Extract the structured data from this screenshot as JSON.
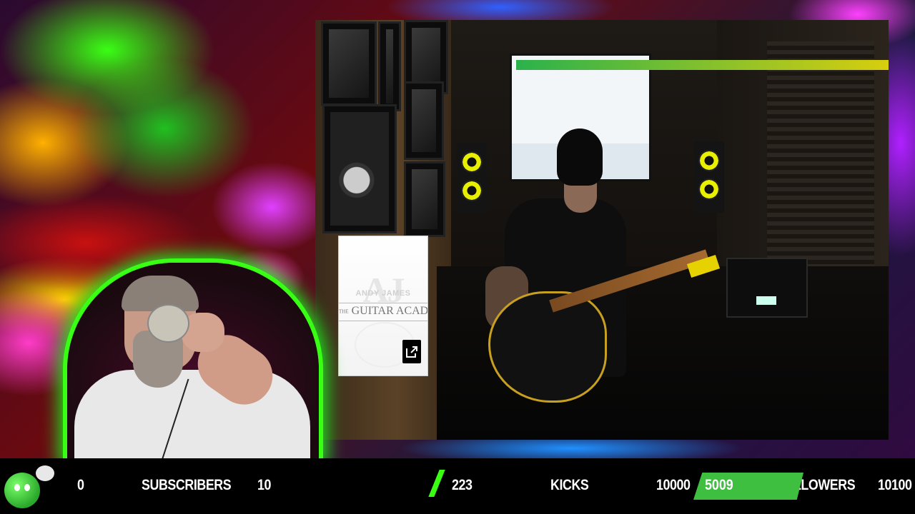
{
  "stats": {
    "subs_current": "0",
    "subs_label": "SUBSCRIBERS",
    "subs_goal": "10",
    "kicks_current": "223",
    "kicks_label": "KICKS",
    "kicks_goal": "10000",
    "followers_current": "5009",
    "followers_label": "FOLLOWERS",
    "followers_goal": "10100",
    "followers_progress_fraction": 0.4959
  },
  "overlay_card": {
    "brand_name": "ANDY JAMES",
    "the": "THE",
    "academy": "GUITAR ACADEMY",
    "external_link_icon": "external-link-icon"
  },
  "colors": {
    "accent_green": "#39ff14",
    "progress_green": "#3fbf3f"
  }
}
